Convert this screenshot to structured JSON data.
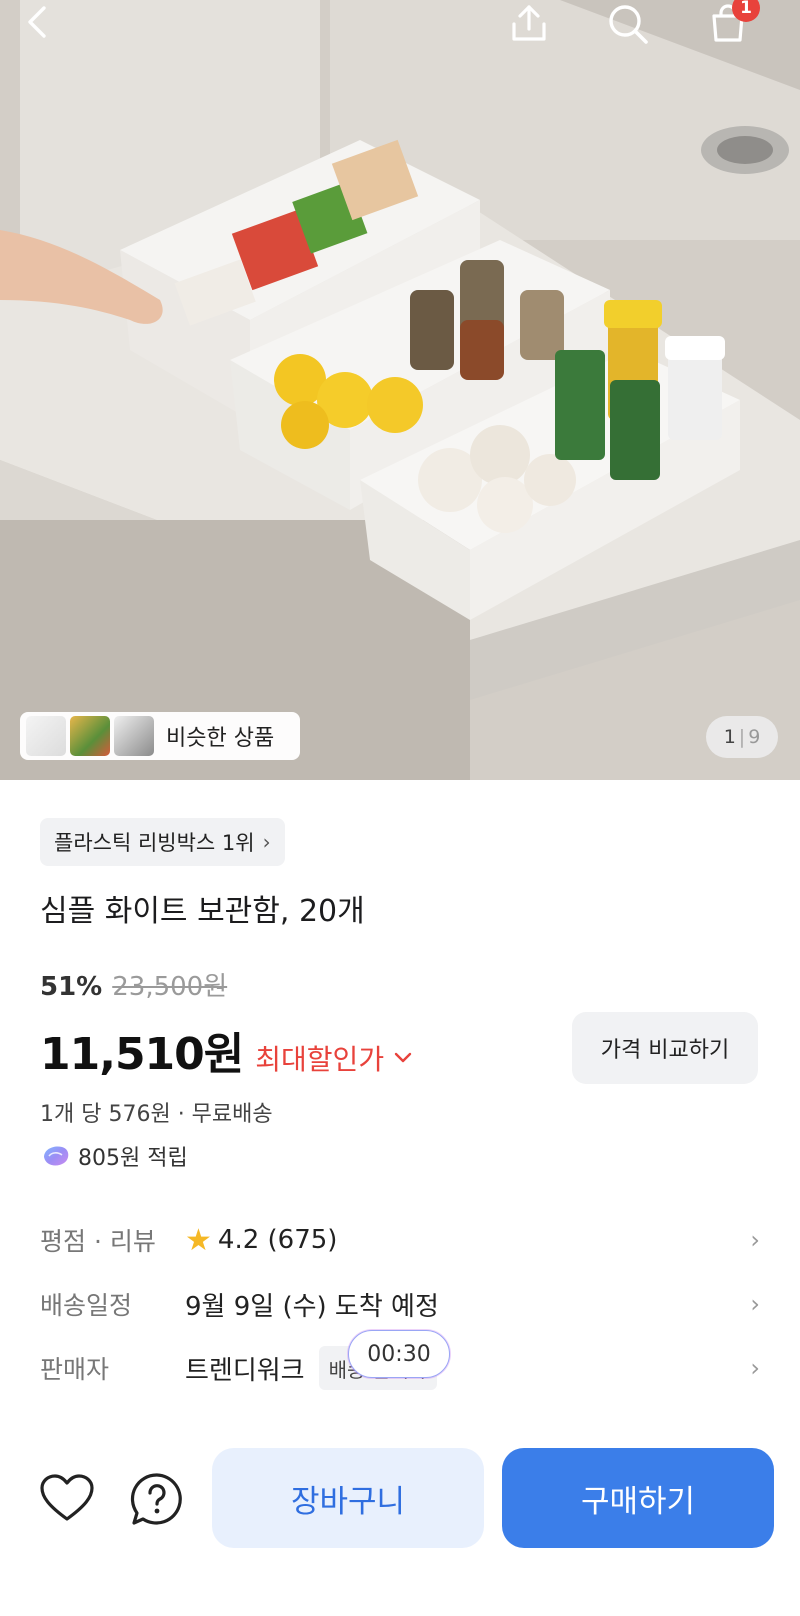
{
  "header": {
    "cart_badge": "1",
    "icons": [
      "chevron-left-icon",
      "share-upload-icon",
      "search-icon",
      "shopping-bag-icon"
    ]
  },
  "gallery": {
    "similar_label": "비슷한 상품",
    "page_current": "1",
    "page_separator": "|",
    "page_total": "9"
  },
  "product": {
    "rank_chip": "플라스틱 리빙박스 1위",
    "title": "심플 화이트 보관함, 20개",
    "discount_percent": "51%",
    "original_price": "23,500원",
    "price": "11,510원",
    "max_discount_label": "최대할인가",
    "compare_label": "가격 비교하기",
    "unit_info": "1개 당 576원 · 무료배송",
    "points": "805원 적립"
  },
  "info": {
    "rating_label": "평점 · 리뷰",
    "rating_value": "4.2 (675)",
    "delivery_label": "배송일정",
    "delivery_value": "9월 9일 (수) 도착 예정",
    "seller_label": "판매자",
    "seller_name": "트렌디워크",
    "seller_badge": "배송 판매자",
    "timer": "00:30"
  },
  "actions": {
    "cart_label": "장바구니",
    "buy_label": "구매하기"
  },
  "colors": {
    "accent_blue": "#3b7ee9",
    "sale_red": "#e8423b",
    "star_yellow": "#f5b826"
  }
}
